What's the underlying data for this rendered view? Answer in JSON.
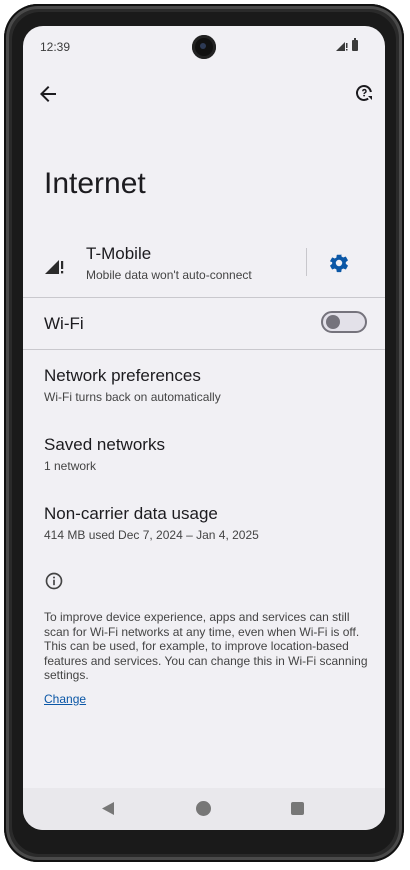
{
  "status_bar": {
    "time": "12:39"
  },
  "page": {
    "title": "Internet"
  },
  "mobile": {
    "carrier": "T-Mobile",
    "subtitle": "Mobile data won't auto-connect"
  },
  "wifi": {
    "label": "Wi-Fi",
    "enabled": false
  },
  "items": [
    {
      "title": "Network preferences",
      "subtitle": "Wi-Fi turns back on automatically"
    },
    {
      "title": "Saved networks",
      "subtitle": "1 network"
    },
    {
      "title": "Non-carrier data usage",
      "subtitle": "414 MB used Dec 7, 2024 – Jan 4, 2025"
    }
  ],
  "info": {
    "text": "To improve device experience, apps and services can still scan for Wi-Fi networks at any time, even when Wi-Fi is off. This can be used, for example, to improve location-based features and services. You can change this in Wi-Fi scanning settings.",
    "link": "Change"
  },
  "colors": {
    "accent": "#0b57a6",
    "background": "#f1f0f4"
  },
  "icons": [
    "arrow-back-icon",
    "help-feedback-icon",
    "signal-icon",
    "gear-icon",
    "info-icon",
    "nav-back-icon",
    "nav-home-icon",
    "nav-recents-icon"
  ]
}
